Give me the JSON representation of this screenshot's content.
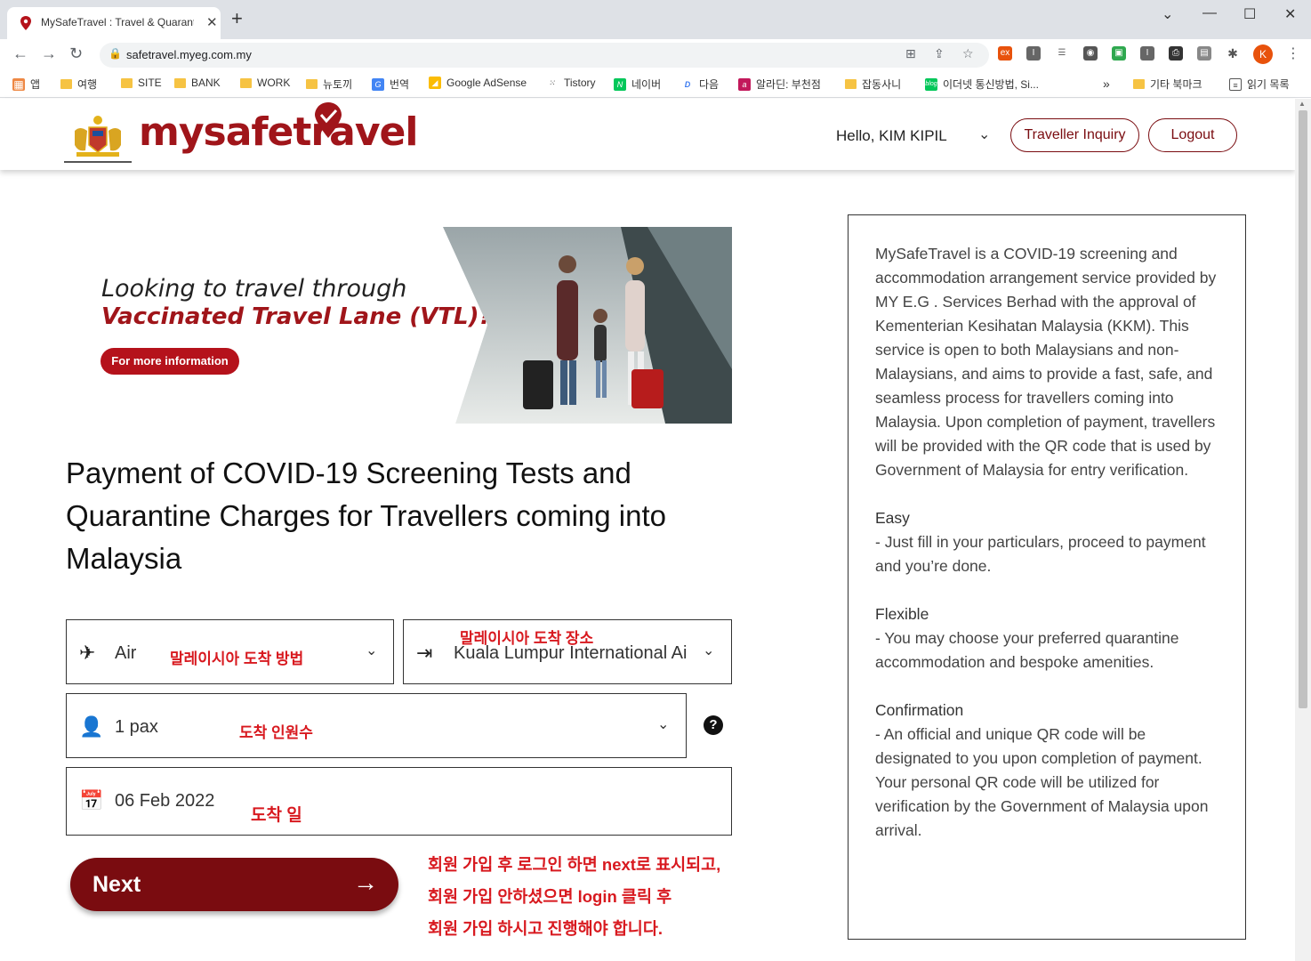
{
  "browser": {
    "tab_title": "MySafeTravel : Travel & Quarant",
    "url": "safetravel.myeg.com.my",
    "bookmarks": [
      "앱",
      "여행",
      "SITE",
      "BANK",
      "WORK",
      "뉴토끼",
      "번역",
      "Google AdSense",
      "Tistory",
      "네이버",
      "다음",
      "알라딘: 부천점",
      "잡동사니",
      "이더넷 통신방법, Si...",
      "기타 북마크",
      "읽기 목록"
    ],
    "avatar_letter": "K"
  },
  "header": {
    "logo": "mysafetravel",
    "greeting": "Hello, KIM KIPIL",
    "inquiry_label": "Traveller Inquiry",
    "logout_label": "Logout"
  },
  "banner": {
    "line1": "Looking to travel through",
    "line2": "Vaccinated Travel Lane (VTL)?",
    "button": "For more information"
  },
  "main": {
    "title": "Payment of COVID-19 Screening Tests and Quarantine Charges for Travellers coming into Malaysia"
  },
  "form": {
    "mode_value": "Air",
    "mode_note": "말레이시아 도착 방법",
    "place_value": "Kuala Lumpur International Ai",
    "place_note": "말레이시아 도착 장소",
    "pax_value": "1 pax",
    "pax_note": "도착 인원수",
    "date_value": "06 Feb 2022",
    "date_note": "도착 일",
    "next_label": "Next"
  },
  "annotation": {
    "line1": "회원 가입 후 로그인 하면 next로 표시되고,",
    "line2": "회원 가입 안하셨으면 login 클릭 후",
    "line3": "회원 가입 하시고 진행해야 합니다."
  },
  "info": {
    "intro": "MySafeTravel is a COVID-19 screening and accommodation arrangement service provided by MY E.G . Services Berhad with the approval of Kementerian Kesihatan Malaysia (KKM). This service is open to both Malaysians and non-Malaysians, and aims to provide a fast, safe, and seamless process for travellers coming into Malaysia. Upon completion of payment, travellers will be provided with the QR code that is used by Government of Malaysia for entry verification.",
    "easy_title": "Easy",
    "easy_text": "- Just fill in your particulars, proceed to payment and you’re done.",
    "flexible_title": "Flexible",
    "flexible_text": "- You may choose your preferred quarantine accommodation and bespoke amenities.",
    "confirm_title": "Confirmation",
    "confirm_text": "- An official and unique QR code will be designated to you upon completion of payment. Your personal QR code will be utilized for verification by the Government of Malaysia upon arrival."
  },
  "colors": {
    "brand": "#a0151a",
    "button": "#7a0c10",
    "note": "#d8191f"
  }
}
